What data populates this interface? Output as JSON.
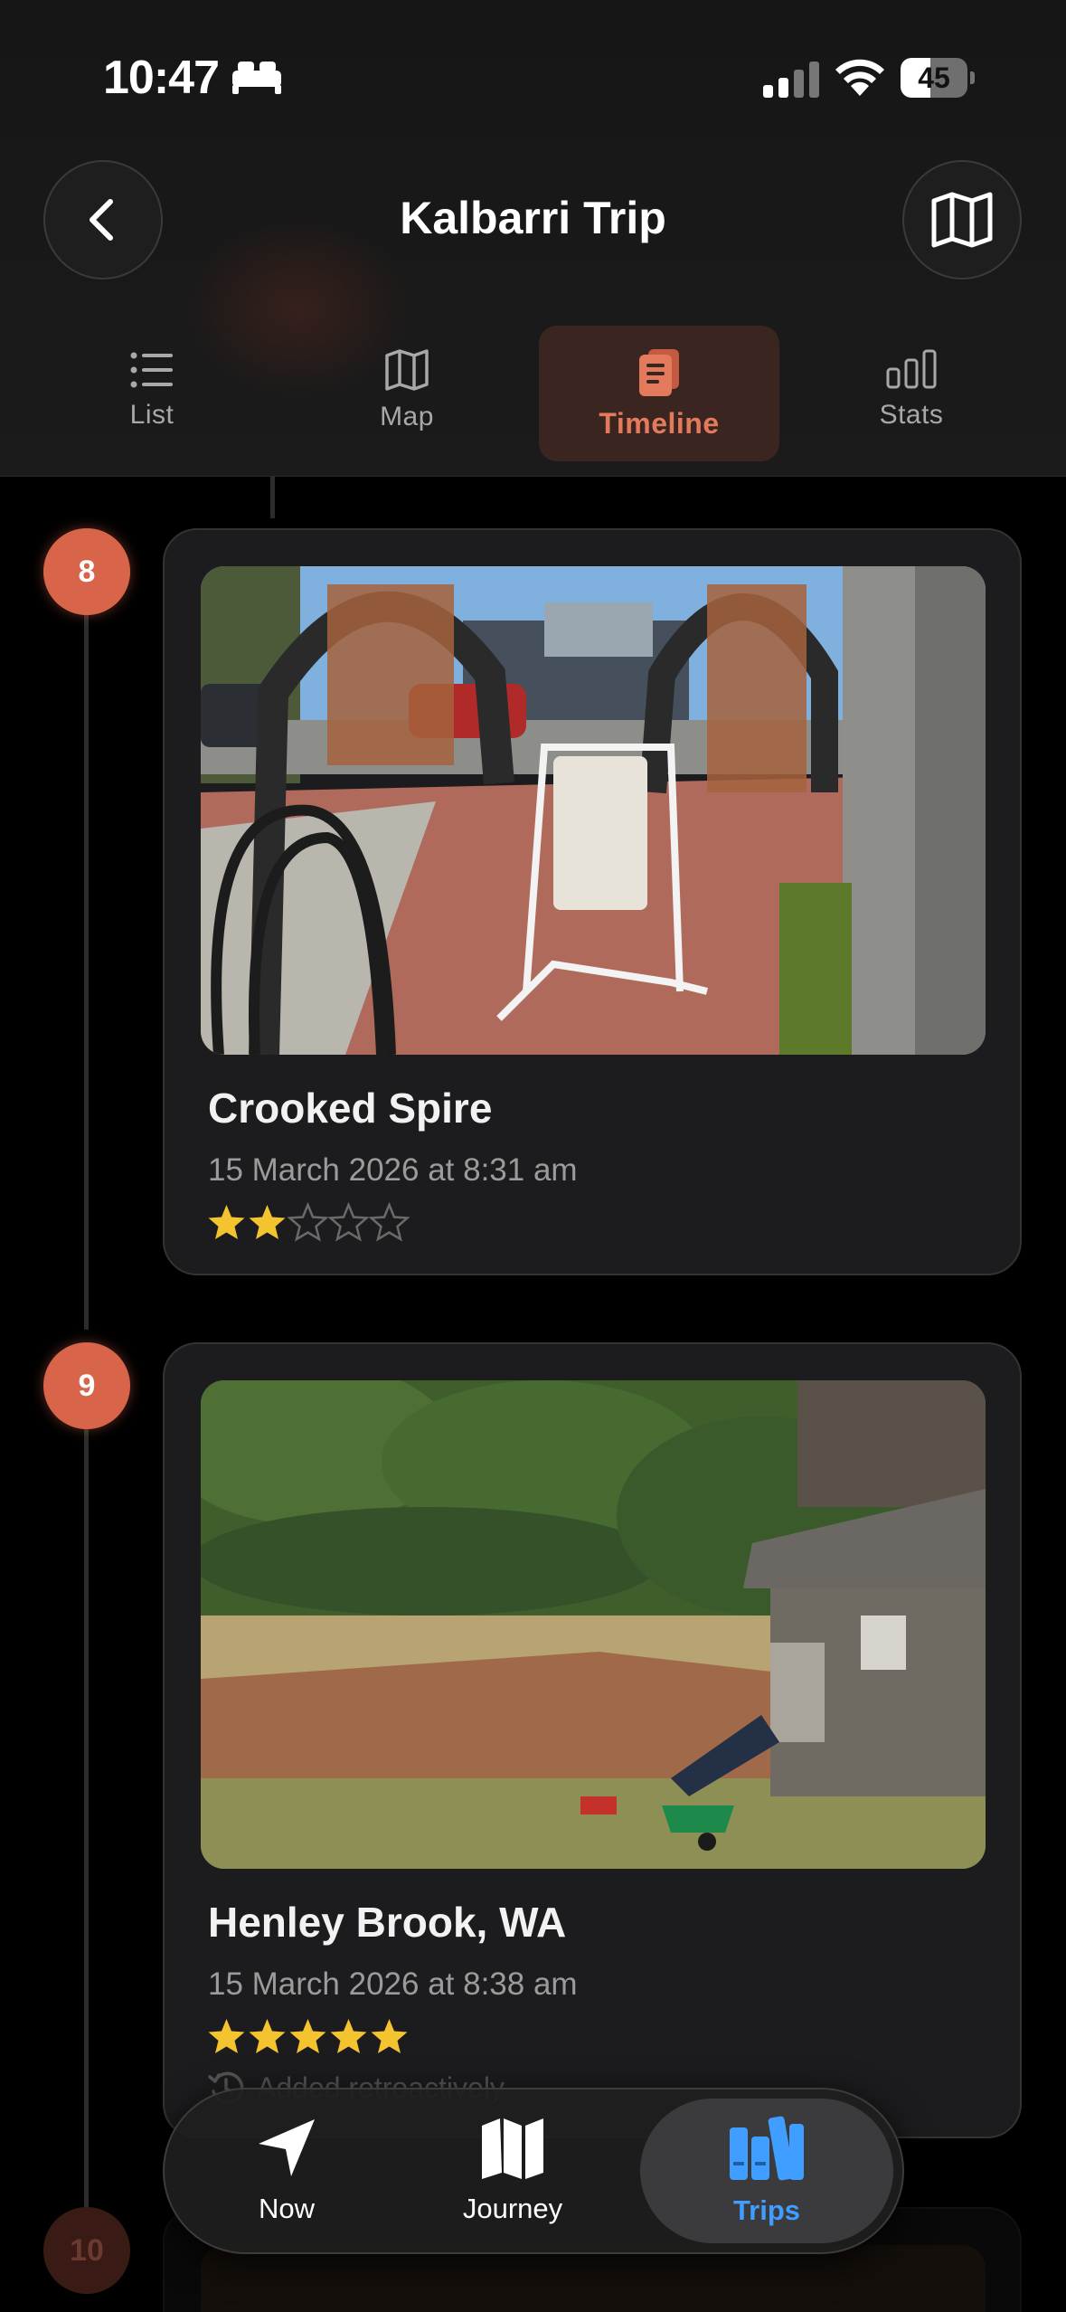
{
  "status_bar": {
    "time": "10:47",
    "battery": "45",
    "battery_level": 0.45
  },
  "header": {
    "title": "Kalbarri Trip"
  },
  "tabs": [
    {
      "label": "List",
      "icon": "list-icon",
      "active": false
    },
    {
      "label": "Map",
      "icon": "map-icon",
      "active": false
    },
    {
      "label": "Timeline",
      "icon": "document-icon",
      "active": true
    },
    {
      "label": "Stats",
      "icon": "bar-chart-icon",
      "active": false
    }
  ],
  "colors": {
    "accent": "#d8644a",
    "active_tab": "#e47a5c",
    "star": "#f4c430",
    "trips_blue": "#3f9eff"
  },
  "entries": [
    {
      "index": "8",
      "title": "Crooked Spire",
      "date": "15 March 2026 at 8:31 am",
      "rating": 2,
      "max_rating": 5
    },
    {
      "index": "9",
      "title": "Henley Brook, WA",
      "date": "15 March 2026 at 8:38 am",
      "rating": 5,
      "max_rating": 5,
      "note": "Added retroactively"
    },
    {
      "index": "10"
    }
  ],
  "bottom_nav": [
    {
      "label": "Now",
      "icon": "location-arrow-icon",
      "active": false
    },
    {
      "label": "Journey",
      "icon": "map-icon",
      "active": false
    },
    {
      "label": "Trips",
      "icon": "books-icon",
      "active": true
    }
  ]
}
